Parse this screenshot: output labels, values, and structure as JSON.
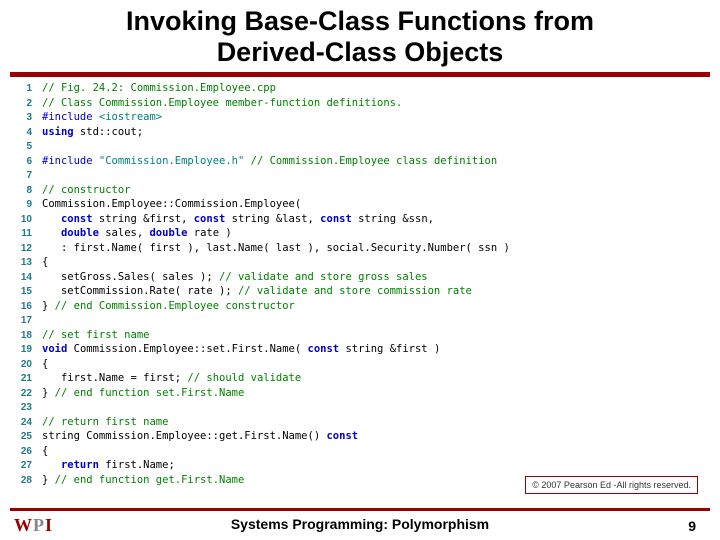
{
  "title_line1": "Invoking Base-Class Functions from",
  "title_line2": "Derived-Class Objects",
  "code": [
    {
      "n": "1",
      "tokens": [
        [
          "comment",
          "// Fig. 24.2: Commission.Employee.cpp"
        ]
      ]
    },
    {
      "n": "2",
      "tokens": [
        [
          "comment",
          "// Class Commission.Employee member-function definitions."
        ]
      ]
    },
    {
      "n": "3",
      "tokens": [
        [
          "preproc",
          "#include "
        ],
        [
          "string",
          "<iostream>"
        ]
      ]
    },
    {
      "n": "4",
      "tokens": [
        [
          "keyword",
          "using"
        ],
        [
          "plain",
          " std::cout;"
        ]
      ]
    },
    {
      "n": "5",
      "tokens": []
    },
    {
      "n": "6",
      "tokens": [
        [
          "preproc",
          "#include "
        ],
        [
          "string",
          "\"Commission.Employee.h\""
        ],
        [
          "plain",
          " "
        ],
        [
          "comment",
          "// Commission.Employee class definition"
        ]
      ]
    },
    {
      "n": "7",
      "tokens": []
    },
    {
      "n": "8",
      "tokens": [
        [
          "comment",
          "// constructor"
        ]
      ]
    },
    {
      "n": "9",
      "tokens": [
        [
          "plain",
          "Commission.Employee::Commission.Employee("
        ]
      ]
    },
    {
      "n": "10",
      "tokens": [
        [
          "plain",
          "   "
        ],
        [
          "keyword",
          "const"
        ],
        [
          "plain",
          " string &first, "
        ],
        [
          "keyword",
          "const"
        ],
        [
          "plain",
          " string &last, "
        ],
        [
          "keyword",
          "const"
        ],
        [
          "plain",
          " string &ssn,"
        ]
      ]
    },
    {
      "n": "11",
      "tokens": [
        [
          "plain",
          "   "
        ],
        [
          "keyword",
          "double"
        ],
        [
          "plain",
          " sales, "
        ],
        [
          "keyword",
          "double"
        ],
        [
          "plain",
          " rate )"
        ]
      ]
    },
    {
      "n": "12",
      "tokens": [
        [
          "plain",
          "   : first.Name( first ), last.Name( last ), social.Security.Number( ssn )"
        ]
      ]
    },
    {
      "n": "13",
      "tokens": [
        [
          "plain",
          "{"
        ]
      ]
    },
    {
      "n": "14",
      "tokens": [
        [
          "plain",
          "   setGross.Sales( sales ); "
        ],
        [
          "comment",
          "// validate and store gross sales"
        ]
      ]
    },
    {
      "n": "15",
      "tokens": [
        [
          "plain",
          "   setCommission.Rate( rate ); "
        ],
        [
          "comment",
          "// validate and store commission rate"
        ]
      ]
    },
    {
      "n": "16",
      "tokens": [
        [
          "plain",
          "} "
        ],
        [
          "comment",
          "// end Commission.Employee constructor"
        ]
      ]
    },
    {
      "n": "17",
      "tokens": []
    },
    {
      "n": "18",
      "tokens": [
        [
          "comment",
          "// set first name"
        ]
      ]
    },
    {
      "n": "19",
      "tokens": [
        [
          "keyword",
          "void"
        ],
        [
          "plain",
          " Commission.Employee::set.First.Name( "
        ],
        [
          "keyword",
          "const"
        ],
        [
          "plain",
          " string &first )"
        ]
      ]
    },
    {
      "n": "20",
      "tokens": [
        [
          "plain",
          "{"
        ]
      ]
    },
    {
      "n": "21",
      "tokens": [
        [
          "plain",
          "   first.Name = first; "
        ],
        [
          "comment",
          "// should validate"
        ]
      ]
    },
    {
      "n": "22",
      "tokens": [
        [
          "plain",
          "} "
        ],
        [
          "comment",
          "// end function set.First.Name"
        ]
      ]
    },
    {
      "n": "23",
      "tokens": []
    },
    {
      "n": "24",
      "tokens": [
        [
          "comment",
          "// return first name"
        ]
      ]
    },
    {
      "n": "25",
      "tokens": [
        [
          "plain",
          "string Commission.Employee::get.First.Name() "
        ],
        [
          "keyword",
          "const"
        ]
      ]
    },
    {
      "n": "26",
      "tokens": [
        [
          "plain",
          "{"
        ]
      ]
    },
    {
      "n": "27",
      "tokens": [
        [
          "plain",
          "   "
        ],
        [
          "keyword",
          "return"
        ],
        [
          "plain",
          " first.Name;"
        ]
      ]
    },
    {
      "n": "28",
      "tokens": [
        [
          "plain",
          "} "
        ],
        [
          "comment",
          "// end function get.First.Name"
        ]
      ]
    }
  ],
  "copyright": "© 2007 Pearson Ed -All rights reserved.",
  "logo": {
    "w": "W",
    "p": "P",
    "i": "I"
  },
  "footer_text": "Systems Programming:  Polymorphism",
  "page_number": "9"
}
